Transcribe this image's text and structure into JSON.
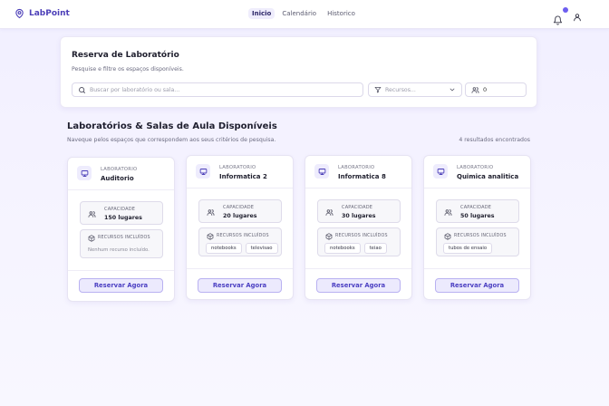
{
  "app": {
    "name": "LabPoint"
  },
  "nav": {
    "links": [
      {
        "label": "Inicio",
        "active": true
      },
      {
        "label": "Calendário",
        "active": false
      },
      {
        "label": "Historico",
        "active": false
      }
    ],
    "icons": [
      "bell-icon",
      "user-icon"
    ]
  },
  "search_panel": {
    "title": "Reserva de Laboratório",
    "subtitle": "Pesquise e filtre os espaços disponíveis.",
    "search_placeholder": "Buscar por laboratório ou sala...",
    "resources_placeholder": "Recursos...",
    "capacity_value": "0"
  },
  "results": {
    "title": "Laboratórios & Salas de Aula Disponíveis",
    "subtitle": "Naveque pelos espaços que correspondem aos seus critérios de pesquisa.",
    "count_text": "4 resultados encontrados"
  },
  "labels": {
    "kind": "LABORATORIO",
    "capacity": "CAPACIDADE",
    "resources": "RECURSOS INCLUÍDOS",
    "reserve_button": "Reservar Agora"
  },
  "cards": [
    {
      "kind": "LABORATORIO",
      "name": "Auditorio",
      "capacity": "150 lugares",
      "resources": [],
      "no_resources": "Nenhum recurso incluído."
    },
    {
      "kind": "LABORATORIO",
      "name": "Informatica 2",
      "capacity": "20 lugares",
      "resources": [
        "notebooks",
        "televisao"
      ]
    },
    {
      "kind": "LABORATORIO",
      "name": "Informatica 8",
      "capacity": "30 lugares",
      "resources": [
        "notebooks",
        "teiao"
      ]
    },
    {
      "kind": "LABORATORIO",
      "name": "Quimica analitica",
      "capacity": "50 lugares",
      "resources": [
        "tubos de ensaio"
      ]
    }
  ],
  "colors": {
    "accent": "#4c3fb8",
    "button_bg": "#eceafd",
    "button_border": "#b9b1f1",
    "notification_dot": "#6d5ef0"
  }
}
